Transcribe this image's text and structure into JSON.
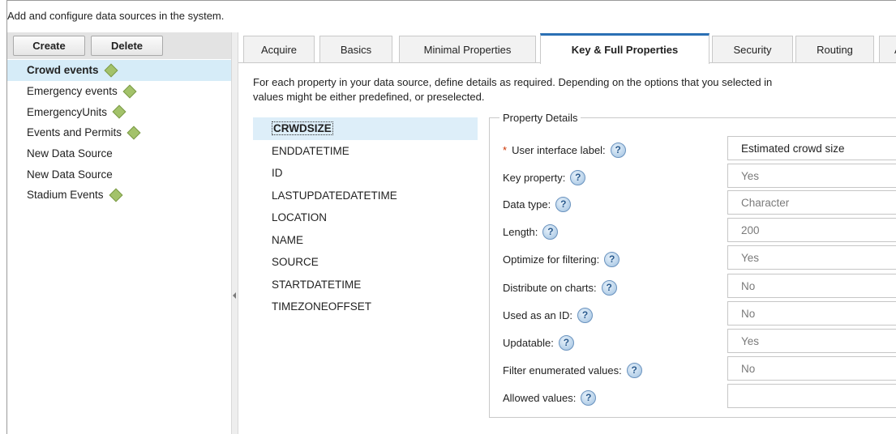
{
  "intro_text": "Add and configure data sources in the system.",
  "toolbar": {
    "create_label": "Create",
    "delete_label": "Delete"
  },
  "data_sources": [
    {
      "label": "Crowd events",
      "has_status": true,
      "selected": true
    },
    {
      "label": "Emergency events",
      "has_status": true,
      "selected": false
    },
    {
      "label": "EmergencyUnits",
      "has_status": true,
      "selected": false
    },
    {
      "label": "Events and Permits",
      "has_status": true,
      "selected": false
    },
    {
      "label": "New Data Source",
      "has_status": false,
      "selected": false
    },
    {
      "label": "New Data Source",
      "has_status": false,
      "selected": false
    },
    {
      "label": "Stadium Events",
      "has_status": true,
      "selected": false
    }
  ],
  "status_color": "#a3c26a",
  "tabs": [
    {
      "label": "Acquire"
    },
    {
      "label": "Basics"
    },
    {
      "label": "Minimal Properties"
    },
    {
      "label": "Key & Full Properties",
      "active": true
    },
    {
      "label": "Security"
    },
    {
      "label": "Routing"
    },
    {
      "label": "A"
    }
  ],
  "description": {
    "line1": "For each property in your data source, define details as required. Depending on the options that you selected in",
    "line2": "values might be either predefined, or preselected."
  },
  "properties": [
    {
      "name": "CRWDSIZE",
      "selected": true
    },
    {
      "name": "ENDDATETIME"
    },
    {
      "name": "ID"
    },
    {
      "name": "LASTUPDATEDATETIME"
    },
    {
      "name": "LOCATION"
    },
    {
      "name": "NAME"
    },
    {
      "name": "SOURCE"
    },
    {
      "name": "STARTDATETIME"
    },
    {
      "name": "TIMEZONEOFFSET"
    }
  ],
  "details": {
    "legend": "Property Details",
    "help_glyph": "?",
    "required_mark": "*",
    "fields": [
      {
        "label": "User interface label:",
        "value": "Estimated crowd size",
        "required": true,
        "editable": true
      },
      {
        "label": "Key property:",
        "value": "Yes"
      },
      {
        "label": "Data type:",
        "value": "Character"
      },
      {
        "label": "Length:",
        "value": "200"
      },
      {
        "label": "Optimize for filtering:",
        "value": "Yes"
      },
      {
        "label": "Distribute on charts:",
        "value": "No"
      },
      {
        "label": "Used as an ID:",
        "value": "No"
      },
      {
        "label": "Updatable:",
        "value": "Yes"
      },
      {
        "label": "Filter enumerated values:",
        "value": "No"
      },
      {
        "label": "Allowed values:",
        "value": "",
        "editable": true
      }
    ]
  }
}
